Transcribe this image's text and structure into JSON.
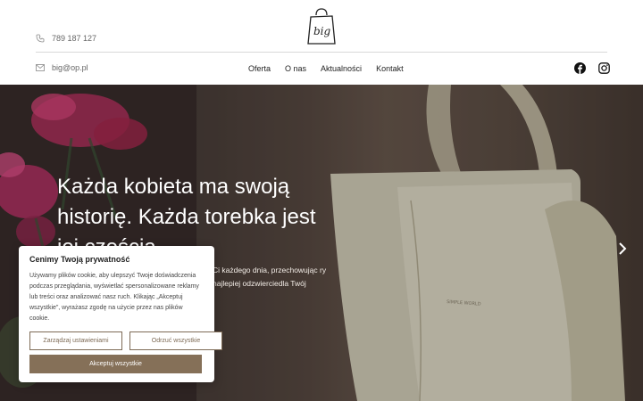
{
  "header": {
    "logo_text": "big",
    "phone": "789 187 127",
    "email": "big@op.pl",
    "nav": [
      "Oferta",
      "O nas",
      "Aktualności",
      "Kontakt"
    ]
  },
  "hero": {
    "title": "Każda kobieta ma swoją historię. Każda torebka jest jej częścią.",
    "text": "Ci każdego dnia, przechowując ry najlepiej odzwierciedla Twój",
    "bag_label": "SIMPLE WORLD"
  },
  "cookie": {
    "title": "Cenimy Twoją prywatność",
    "text": "Używamy plików cookie, aby ulepszyć Twoje doświadczenia podczas przeglądania, wyświetlać spersonalizowane reklamy lub treści oraz analizować nasz ruch. Klikając „Akceptuj wszystkie”, wyrażasz zgodę na użycie przez nas plików cookie.",
    "manage_label": "Zarządzaj ustawieniami",
    "reject_label": "Odrzuć wszystkie",
    "accept_label": "Akceptuj wszystkie"
  },
  "colors": {
    "accent": "#857058",
    "hero_dark": "#3d3330"
  }
}
